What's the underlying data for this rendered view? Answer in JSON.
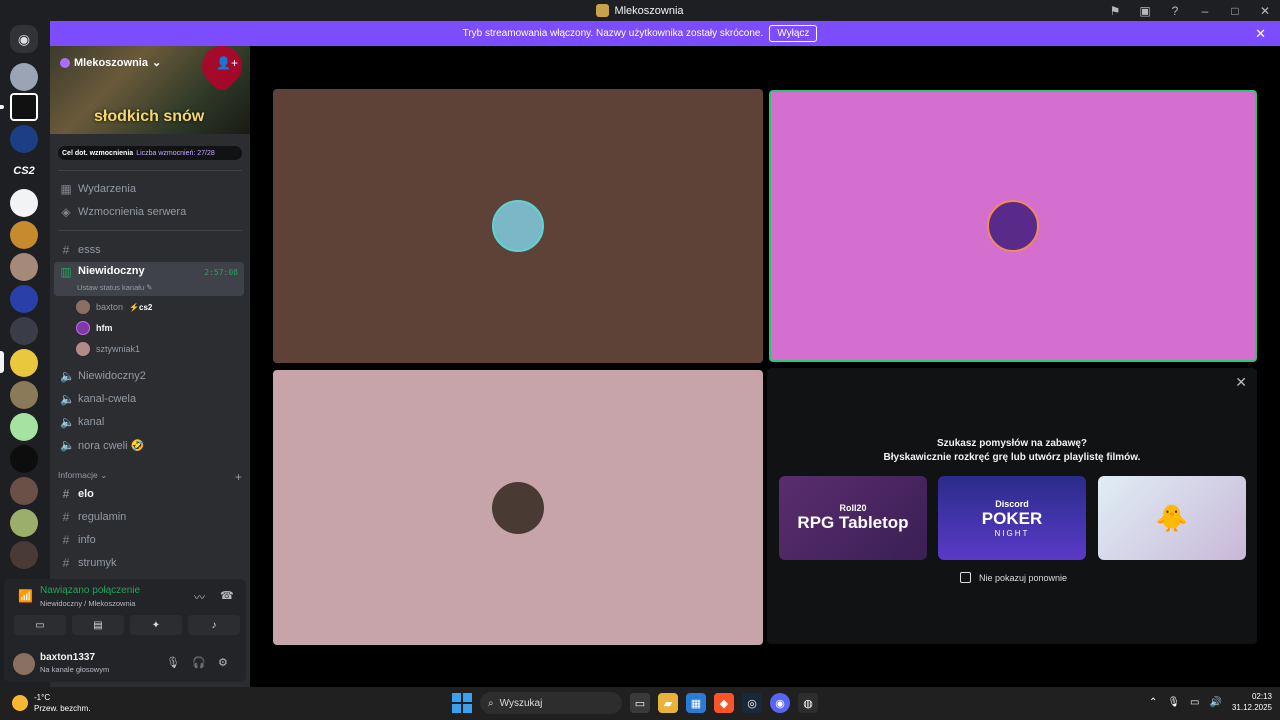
{
  "window": {
    "title": "Mlekoszownia",
    "controls": [
      "flag-icon",
      "inbox-icon",
      "help-icon",
      "minimize-icon",
      "maximize-icon",
      "close-icon"
    ]
  },
  "banner": {
    "text": "Tryb streamowania włączony. Nazwy użytkownika zostały skrócone.",
    "button": "Wyłącz"
  },
  "server": {
    "name": "Mlekoszownia",
    "banner_text": "słodkich snów",
    "boost_goal_label": "Cel dot. wzmocnienia",
    "boost_count_label": "Liczba wzmocnień: 27/28"
  },
  "sidebar": {
    "events": "Wydarzenia",
    "boosts": "Wzmocnienia serwera",
    "channels": [
      {
        "name": "esss",
        "type": "text"
      },
      {
        "name": "Niewidoczny",
        "type": "voice",
        "active": true,
        "timer": "2:57:08",
        "status": "Ustaw status kanału"
      },
      {
        "name": "Niewidoczny2",
        "type": "voice"
      },
      {
        "name": "kanal-cwela",
        "type": "voice"
      },
      {
        "name": "kanal",
        "type": "voice"
      },
      {
        "name": "nora cweli 🤣",
        "type": "voice"
      }
    ],
    "voice_users": [
      {
        "name": "baxton",
        "activity": "cs2"
      },
      {
        "name": "hfm"
      },
      {
        "name": "sztywniak1"
      }
    ],
    "category": "Informacje",
    "info_channels": [
      {
        "name": "elo",
        "bold": true
      },
      {
        "name": "regulamin"
      },
      {
        "name": "info"
      },
      {
        "name": "strumyk"
      }
    ]
  },
  "voice_panel": {
    "status": "Nawiązano połączenie",
    "location": "Niewidoczny / Mlekoszownia"
  },
  "user": {
    "name": "baxton1337",
    "status": "Na kanale głosowym"
  },
  "activity_prompt": {
    "line1": "Szukasz pomysłów na zabawę?",
    "line2": "Błyskawicznie rozkręć grę lub utwórz playlistę filmów.",
    "cards": [
      {
        "top": "Roll20",
        "title": "RPG Tabletop"
      },
      {
        "top": "Discord",
        "title": "POKER",
        "sub": "NIGHT"
      },
      {
        "title": ""
      }
    ],
    "dont_show": "Nie pokazuj ponownie"
  },
  "taskbar": {
    "temp": "-1°C",
    "weather": "Przew. bezchm.",
    "search": "Wyszukaj",
    "time": "02:13",
    "date": "31.12.2025"
  },
  "colors": {
    "accent": "#7c4dff",
    "online": "#23a55a",
    "tile1": "#5e4238",
    "tile2": "#d46fd0",
    "tile3": "#c6a4a9"
  }
}
